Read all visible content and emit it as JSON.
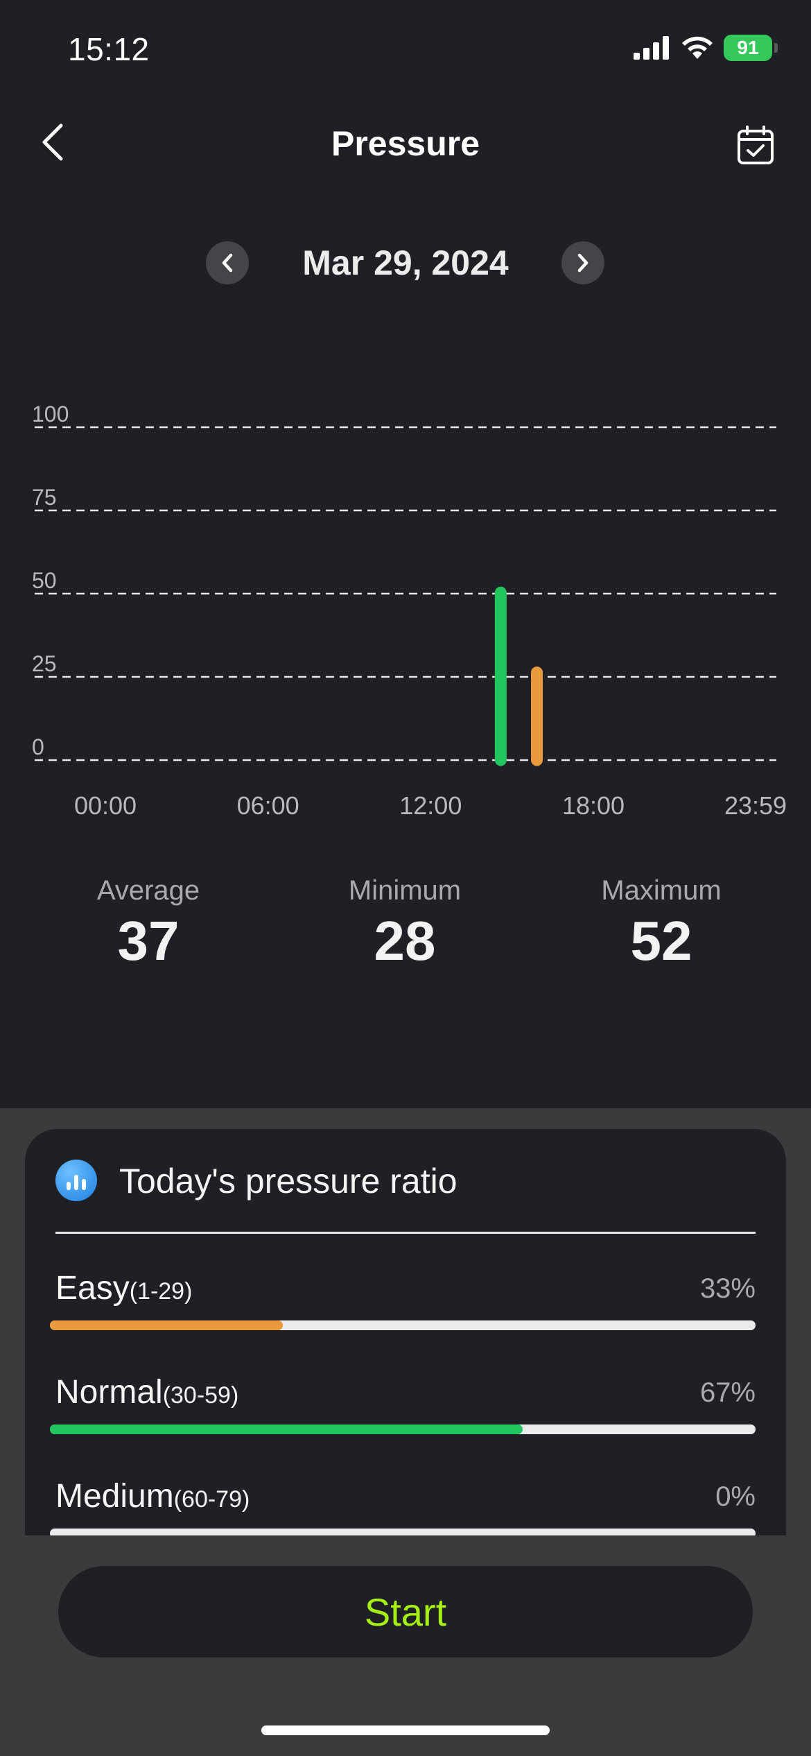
{
  "status_bar": {
    "time": "15:12",
    "battery": "91"
  },
  "header": {
    "title": "Pressure"
  },
  "date_nav": {
    "date": "Mar 29, 2024"
  },
  "chart_data": {
    "type": "bar",
    "x_axis_ticks": [
      "00:00",
      "06:00",
      "12:00",
      "18:00",
      "23:59"
    ],
    "y_axis_ticks": [
      "100",
      "75",
      "50",
      "25",
      "0"
    ],
    "ylim": [
      0,
      100
    ],
    "grid": true,
    "points": [
      {
        "time": "14:35",
        "value": 52,
        "level": "Normal",
        "color": "#22c55e"
      },
      {
        "time": "15:55",
        "value": 28,
        "level": "Easy",
        "color": "#e89a3c"
      }
    ]
  },
  "stats": {
    "average_label": "Average",
    "average_value": "37",
    "minimum_label": "Minimum",
    "minimum_value": "28",
    "maximum_label": "Maximum",
    "maximum_value": "52"
  },
  "ratio": {
    "title": "Today's pressure ratio",
    "items": [
      {
        "name": "Easy",
        "range": "(1-29)",
        "percent": "33%",
        "fraction": 0.33,
        "color": "#e89a3c"
      },
      {
        "name": "Normal",
        "range": "(30-59)",
        "percent": "67%",
        "fraction": 0.67,
        "color": "#22c55e"
      },
      {
        "name": "Medium",
        "range": "(60-79)",
        "percent": "0%",
        "fraction": 0,
        "color": "#f5a623"
      }
    ]
  },
  "actions": {
    "start_label": "Start"
  },
  "colors": {
    "accent_start": "#a6ef16",
    "background": "#1f2025"
  }
}
